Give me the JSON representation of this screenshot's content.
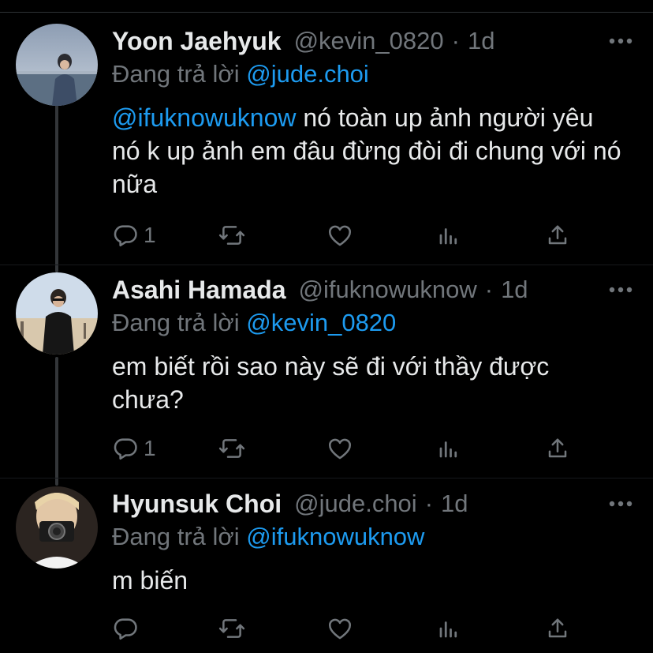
{
  "tweets": [
    {
      "name": "Yoon Jaehyuk",
      "handle": "@kevin_0820",
      "time": "1d",
      "replying_prefix": "Đang trả lời",
      "replying_to": "@jude.choi",
      "mention": "@ifuknowuknow",
      "text": " nó toàn up ảnh người yêu nó k up ảnh em đâu đừng đòi đi chung với nó nữa",
      "reply_count": "1",
      "avatar_icon": "avatar-sea-photo"
    },
    {
      "name": "Asahi Hamada",
      "handle": "@ifuknowuknow",
      "time": "1d",
      "replying_prefix": "Đang trả lời",
      "replying_to": "@kevin_0820",
      "mention": "",
      "text": "em biết rồi sao này sẽ đi với thầy được chưa?",
      "reply_count": "1",
      "avatar_icon": "avatar-beach-photo"
    },
    {
      "name": "Hyunsuk Choi",
      "handle": "@jude.choi",
      "time": "1d",
      "replying_prefix": "Đang trả lời",
      "replying_to": "@ifuknowuknow",
      "mention": "",
      "text": "m biến",
      "reply_count": "",
      "avatar_icon": "avatar-camera-photo"
    }
  ],
  "meta_separator": "·",
  "icons": [
    "reply-icon",
    "retweet-icon",
    "like-icon",
    "analytics-icon",
    "share-icon",
    "more-icon"
  ],
  "colors": {
    "background": "#000000",
    "text": "#e7e9ea",
    "secondary": "#71767b",
    "link": "#1d9bf0"
  }
}
